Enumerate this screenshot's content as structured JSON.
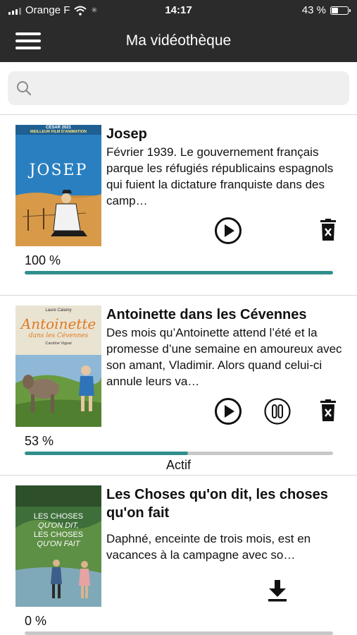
{
  "status_bar": {
    "carrier": "Orange F",
    "time": "14:17",
    "battery": "43 %",
    "battery_level": 0.43
  },
  "nav": {
    "title": "Ma vidéothèque",
    "menu_icon": "hamburger-menu-icon"
  },
  "search": {
    "placeholder": "",
    "value": "",
    "icon": "search-icon"
  },
  "videos": [
    {
      "title": "Josep",
      "poster_text": [
        "CÉSAR 2021",
        "MEILLEUR FILM D'ANIMATION",
        "JOSEP"
      ],
      "description": "Février 1939. Le gouvernement français parque les réfugiés républicains espagnols qui fuient la dictature franquiste dans des camp…",
      "progress_label": "100 %",
      "progress": 1.0,
      "actions": [
        "play-icon",
        "trash-icon"
      ]
    },
    {
      "title": "Antoinette dans les Cévennes",
      "poster_text": [
        "Laure Calamy",
        "Antoinette",
        "dans les Cévennes",
        "Caroline Vignal"
      ],
      "description": "Des mois qu’Antoinette attend l’été et la promesse d’une semaine en amoureux avec son amant, Vladimir. Alors quand celui-ci annule leurs va…",
      "progress_label": "53 %",
      "progress": 0.53,
      "status": "Actif",
      "actions": [
        "play-icon",
        "pause-icon",
        "trash-icon"
      ]
    },
    {
      "title": "Les Choses qu'on dit, les choses qu'on fait",
      "poster_text": [
        "LES CHOSES",
        "QU'ON DIT,",
        "LES CHOSES",
        "QU'ON FAIT"
      ],
      "description": "Daphné, enceinte de trois mois, est en vacances à la campagne avec so…",
      "progress_label": "0 %",
      "progress": 0.0,
      "actions": [
        "download-icon"
      ]
    }
  ],
  "colors": {
    "header_bg": "#2b2b2b",
    "progress_fill": "#2f8f8a",
    "progress_track": "#c8c8c8",
    "search_bg": "#efefef"
  }
}
